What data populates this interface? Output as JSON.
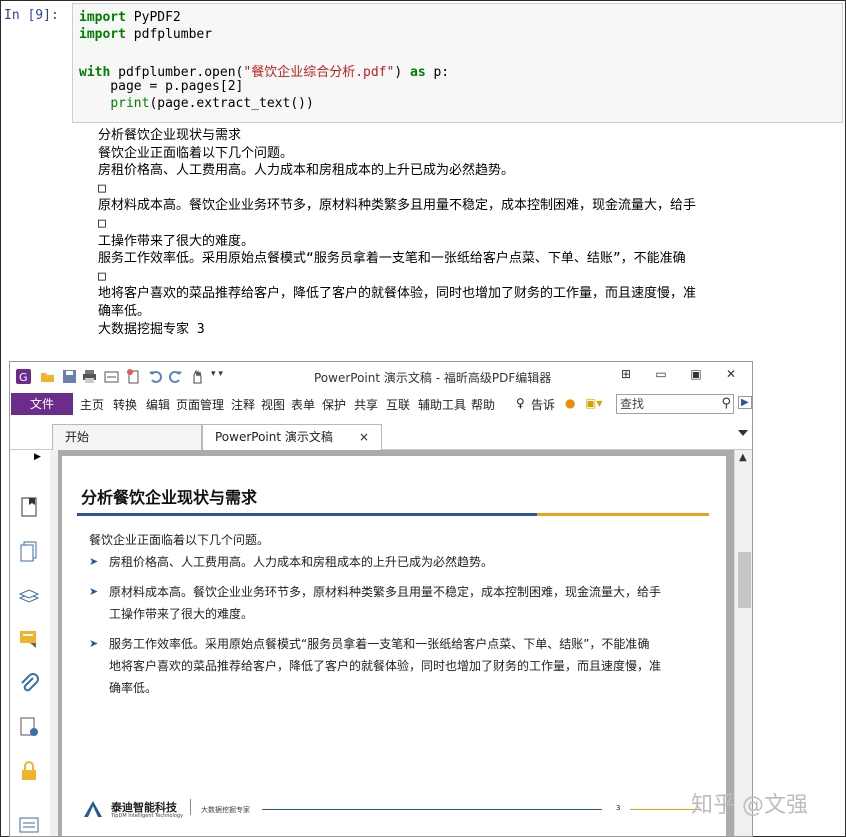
{
  "notebook": {
    "prompt": "In  [9]:",
    "code_lines": [
      {
        "kw": "import",
        "rest": " PyPDF2"
      },
      {
        "kw": "import",
        "rest": " pdfplumber"
      },
      {
        "kw": "",
        "rest": ""
      },
      {
        "kw": "with",
        "pre": " pdfplumber.open(",
        "str": "\"餐饮企业综合分析.pdf\"",
        "post": ") ",
        "kw2": "as",
        "rest": " p:"
      },
      {
        "indent": "    page = p.pages[2]"
      },
      {
        "builtin": "print",
        "rest": "(page.extract_text())"
      }
    ],
    "output_lines": [
      "分析餐饮企业现状与需求",
      "餐饮企业正面临着以下几个问题。",
      "房租价格高、人工费用高。人力成本和房租成本的上升已成为必然趋势。",
      "□",
      "原材料成本高。餐饮企业业务环节多，原材料种类繁多且用量不稳定，成本控制困难，现金流量大，给手",
      "□",
      "工操作带来了很大的难度。",
      "服务工作效率低。采用原始点餐模式“服务员拿着一支笔和一张纸给客户点菜、下单、结账”，不能准确",
      "□",
      "地将客户喜欢的菜品推荐给客户，降低了客户的就餐体验，同时也增加了财务的工作量，而且速度慢，准",
      "确率低。",
      "大数据挖掘专家 3"
    ]
  },
  "foxit": {
    "title": "PowerPoint 演示文稿 - 福昕高级PDF编辑器",
    "menu_file": "文件",
    "menu_items": [
      "主页",
      "转换",
      "编辑",
      "页面管理",
      "注释",
      "视图",
      "表单",
      "保护",
      "共享",
      "互联",
      "辅助工具",
      "帮助",
      "告诉"
    ],
    "search_placeholder": "查找",
    "tabs": [
      {
        "label": "开始"
      },
      {
        "label": "PowerPoint 演示文稿",
        "close": "×"
      }
    ],
    "slide": {
      "title": "分析餐饮企业现状与需求",
      "intro": "餐饮企业正面临着以下几个问题。",
      "bullets": [
        {
          "lines": [
            "房租价格高、人工费用高。人力成本和房租成本的上升已成为必然趋势。"
          ]
        },
        {
          "lines": [
            "原材料成本高。餐饮企业业务环节多，原材料种类繁多且用量不稳定，成本控制困难，现金流量大，给手",
            "工操作带来了很大的难度。"
          ]
        },
        {
          "lines": [
            "服务工作效率低。采用原始点餐模式“服务员拿着一支笔和一张纸给客户点菜、下单、结账”，不能准确",
            "地将客户喜欢的菜品推荐给客户，降低了客户的就餐体验，同时也增加了财务的工作量，而且速度慢，准",
            "确率低。"
          ]
        }
      ],
      "footer_company": "泰迪智能科技",
      "footer_company_en": "TipDM Intelligent Technology",
      "footer_sub": "大数据挖掘专家",
      "page_number": "3"
    }
  },
  "watermark": "知乎 @文强",
  "colors": {
    "accent_purple": "#6b2c8c",
    "slide_blue": "#2b5797",
    "slide_orange": "#e8a317",
    "prompt_blue": "#303f9f"
  }
}
